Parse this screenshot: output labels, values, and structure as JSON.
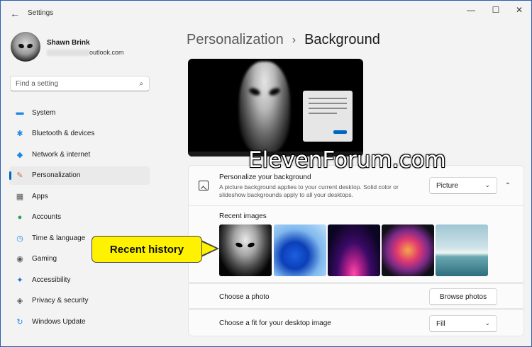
{
  "window": {
    "title": "Settings",
    "back_icon": "←",
    "min_icon": "—",
    "max_icon": "☐",
    "close_icon": "✕"
  },
  "profile": {
    "name": "Shawn Brink",
    "email_visible": "outlook.com"
  },
  "search": {
    "placeholder": "Find a setting",
    "icon": "⌕"
  },
  "nav": {
    "items": [
      {
        "label": "System",
        "icon": "▬",
        "color": "#1e88e5"
      },
      {
        "label": "Bluetooth & devices",
        "icon": "✱",
        "color": "#1e88e5"
      },
      {
        "label": "Network & internet",
        "icon": "◆",
        "color": "#1e88e5"
      },
      {
        "label": "Personalization",
        "icon": "✎",
        "color": "#d16a32"
      },
      {
        "label": "Apps",
        "icon": "▦",
        "color": "#5a5a5a"
      },
      {
        "label": "Accounts",
        "icon": "●",
        "color": "#2e9e5a"
      },
      {
        "label": "Time & language",
        "icon": "◷",
        "color": "#1e88e5"
      },
      {
        "label": "Gaming",
        "icon": "◉",
        "color": "#5a5a5a"
      },
      {
        "label": "Accessibility",
        "icon": "✦",
        "color": "#1e6fd0"
      },
      {
        "label": "Privacy & security",
        "icon": "◈",
        "color": "#5a5a5a"
      },
      {
        "label": "Windows Update",
        "icon": "↻",
        "color": "#1e88e5"
      }
    ],
    "active_index": 3
  },
  "breadcrumb": {
    "parent": "Personalization",
    "separator": "›",
    "current": "Background"
  },
  "watermark": "ElevenForum.com",
  "background_card": {
    "title": "Personalize your background",
    "description": "A picture background applies to your current desktop. Solid color or slideshow backgrounds apply to all your desktops.",
    "dropdown_value": "Picture",
    "chevron_down": "⌄",
    "chevron_up": "⌃"
  },
  "recent": {
    "label": "Recent images"
  },
  "photo_row": {
    "label": "Choose a photo",
    "button": "Browse photos"
  },
  "fit_row": {
    "label": "Choose a fit for your desktop image",
    "dropdown_value": "Fill"
  },
  "callout": {
    "text": "Recent history",
    "color": "#fff200"
  },
  "accent_color": "#0067c0"
}
